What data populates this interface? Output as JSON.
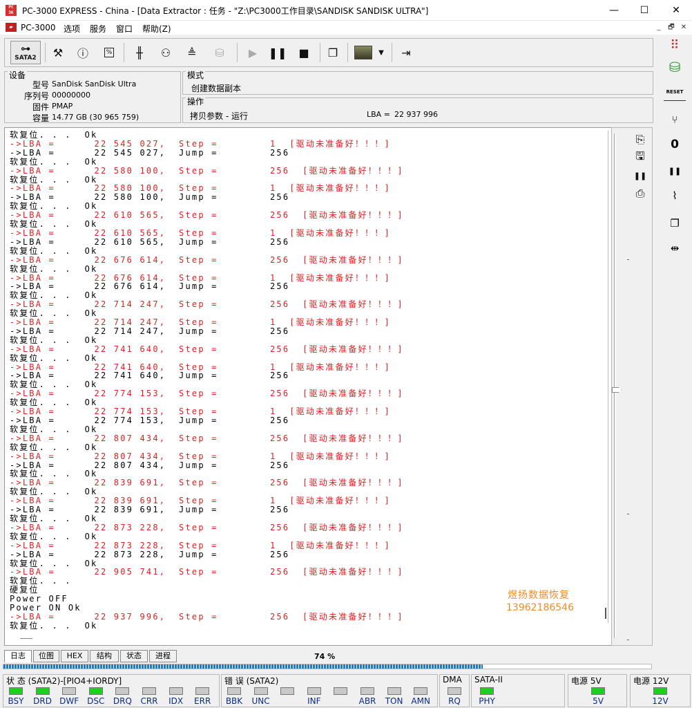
{
  "window": {
    "title": "PC-3000 EXPRESS - China - [Data Extractor : 任务 - \"Z:\\PC3000工作目录\\SANDISK SANDISK ULTRA\"]",
    "icon_text": "PC 3K",
    "minimize": "—",
    "maximize": "☐",
    "close": "✕"
  },
  "menu": {
    "items": [
      "PC-3000",
      "选项",
      "服务",
      "窗口",
      "帮助(Z)"
    ],
    "mdi_min": "_",
    "mdi_restore": "🗗",
    "mdi_close": "✕"
  },
  "toolbar": {
    "sata_label": "SATA2",
    "sata_icon": "⊶",
    "icons": [
      "wrench-hammer-icon",
      "disk-info-icon",
      "percent-100-icon",
      "head-config-icon",
      "binoculars-icon",
      "drive-tools-icon",
      "copy-db-icon",
      "play-icon",
      "pause-icon",
      "stop-icon",
      "windows-icon",
      "image-dropdown-icon",
      "exit-icon"
    ],
    "glyphs": {
      "tools": "⚒",
      "info": "ⓘ",
      "pct": "%",
      "head": "╫",
      "bino": "⚇",
      "drive": "≜",
      "copydb": "⛁",
      "play": "▶",
      "pause": "❚❚",
      "stop": "■",
      "windows": "❐",
      "img": "▦",
      "dd": "▼",
      "exit": "⇥"
    }
  },
  "device": {
    "group_title": "设备",
    "model_label": "型号",
    "model": "SanDisk SanDisk Ultra",
    "serial_label": "序列号",
    "serial": "00000000",
    "firmware_label": "固件",
    "firmware": "PMAP",
    "capacity_label": "容量",
    "capacity": "14.77 GB (30 965 759)"
  },
  "mode": {
    "group_title": "模式",
    "value": "创建数据副本"
  },
  "operation": {
    "group_title": "操作",
    "value": "拷贝参数 - 运行",
    "lba_label": "LBA =",
    "lba": "22 937 996"
  },
  "log": [
    {
      "c": "k",
      "t": "软复位. . .  Ok"
    },
    {
      "c": "r",
      "t": "->LBA =      22 545 027,  Step =        1  [驱动未准备好！！！]"
    },
    {
      "c": "k",
      "t": "->LBA =      22 545 027,  Jump =        256"
    },
    {
      "c": "k",
      "t": "软复位. . .  Ok"
    },
    {
      "c": "r",
      "t": "->LBA =      22 580 100,  Step =        256  [驱动未准备好！！！]"
    },
    {
      "c": "k",
      "t": "软复位. . .  Ok"
    },
    {
      "c": "r",
      "t": "->LBA =      22 580 100,  Step =        1  [驱动未准备好！！！]"
    },
    {
      "c": "k",
      "t": "->LBA =      22 580 100,  Jump =        256"
    },
    {
      "c": "k",
      "t": "软复位. . .  Ok"
    },
    {
      "c": "r",
      "t": "->LBA =      22 610 565,  Step =        256  [驱动未准备好！！！]"
    },
    {
      "c": "k",
      "t": "软复位. . .  Ok"
    },
    {
      "c": "r",
      "t": "->LBA =      22 610 565,  Step =        1  [驱动未准备好！！！]"
    },
    {
      "c": "k",
      "t": "->LBA =      22 610 565,  Jump =        256"
    },
    {
      "c": "k",
      "t": "软复位. . .  Ok"
    },
    {
      "c": "r",
      "t": "->LBA =      22 676 614,  Step =        256  [驱动未准备好！！！]"
    },
    {
      "c": "k",
      "t": "软复位. . .  Ok"
    },
    {
      "c": "r",
      "t": "->LBA =      22 676 614,  Step =        1  [驱动未准备好！！！]"
    },
    {
      "c": "k",
      "t": "->LBA =      22 676 614,  Jump =        256"
    },
    {
      "c": "k",
      "t": "软复位. . .  Ok"
    },
    {
      "c": "r",
      "t": "->LBA =      22 714 247,  Step =        256  [驱动未准备好！！！]"
    },
    {
      "c": "k",
      "t": "软复位. . .  Ok"
    },
    {
      "c": "r",
      "t": "->LBA =      22 714 247,  Step =        1  [驱动未准备好！！！]"
    },
    {
      "c": "k",
      "t": "->LBA =      22 714 247,  Jump =        256"
    },
    {
      "c": "k",
      "t": "软复位. . .  Ok"
    },
    {
      "c": "r",
      "t": "->LBA =      22 741 640,  Step =        256  [驱动未准备好！！！]"
    },
    {
      "c": "k",
      "t": "软复位. . .  Ok"
    },
    {
      "c": "r",
      "t": "->LBA =      22 741 640,  Step =        1  [驱动未准备好！！！]"
    },
    {
      "c": "k",
      "t": "->LBA =      22 741 640,  Jump =        256"
    },
    {
      "c": "k",
      "t": "软复位. . .  Ok"
    },
    {
      "c": "r",
      "t": "->LBA =      22 774 153,  Step =        256  [驱动未准备好！！！]"
    },
    {
      "c": "k",
      "t": "软复位. . .  Ok"
    },
    {
      "c": "r",
      "t": "->LBA =      22 774 153,  Step =        1  [驱动未准备好！！！]"
    },
    {
      "c": "k",
      "t": "->LBA =      22 774 153,  Jump =        256"
    },
    {
      "c": "k",
      "t": "软复位. . .  Ok"
    },
    {
      "c": "r",
      "t": "->LBA =      22 807 434,  Step =        256  [驱动未准备好！！！]"
    },
    {
      "c": "k",
      "t": "软复位. . .  Ok"
    },
    {
      "c": "r",
      "t": "->LBA =      22 807 434,  Step =        1  [驱动未准备好！！！]"
    },
    {
      "c": "k",
      "t": "->LBA =      22 807 434,  Jump =        256"
    },
    {
      "c": "k",
      "t": "软复位. . .  Ok"
    },
    {
      "c": "r",
      "t": "->LBA =      22 839 691,  Step =        256  [驱动未准备好！！！]"
    },
    {
      "c": "k",
      "t": "软复位. . .  Ok"
    },
    {
      "c": "r",
      "t": "->LBA =      22 839 691,  Step =        1  [驱动未准备好！！！]"
    },
    {
      "c": "k",
      "t": "->LBA =      22 839 691,  Jump =        256"
    },
    {
      "c": "k",
      "t": "软复位. . .  Ok"
    },
    {
      "c": "r",
      "t": "->LBA =      22 873 228,  Step =        256  [驱动未准备好！！！]"
    },
    {
      "c": "k",
      "t": "软复位. . .  Ok"
    },
    {
      "c": "r",
      "t": "->LBA =      22 873 228,  Step =        1  [驱动未准备好！！！]"
    },
    {
      "c": "k",
      "t": "->LBA =      22 873 228,  Jump =        256"
    },
    {
      "c": "k",
      "t": "软复位. . .  Ok"
    },
    {
      "c": "r",
      "t": "->LBA =      22 905 741,  Step =        256  [驱动未准备好！！！]"
    },
    {
      "c": "k",
      "t": "软复位. . ."
    },
    {
      "c": "k",
      "t": "硬复位"
    },
    {
      "c": "k",
      "t": "Power OFF"
    },
    {
      "c": "k",
      "t": "Power ON Ok"
    },
    {
      "c": "r",
      "t": "->LBA =      22 937 996,  Step =        256  [驱动未准备好！！！]"
    },
    {
      "c": "k",
      "t": "软复位. . .  Ok"
    }
  ],
  "watermark": {
    "line1": "煜扬数据恢复",
    "line2": "13962186546"
  },
  "tabs": [
    "日志",
    "位图",
    "HEX",
    "结构",
    "状态",
    "进程"
  ],
  "progress": {
    "label": "74 %",
    "fraction": 0.74
  },
  "status": {
    "group1_title": "状 态 (SATA2)-[PIO4+IORDY]",
    "group1": [
      {
        "name": "BSY",
        "on": true
      },
      {
        "name": "DRD",
        "on": true
      },
      {
        "name": "DWF",
        "on": false
      },
      {
        "name": "DSC",
        "on": true
      },
      {
        "name": "DRQ",
        "on": false
      },
      {
        "name": "CRR",
        "on": false
      },
      {
        "name": "IDX",
        "on": false
      },
      {
        "name": "ERR",
        "on": false
      }
    ],
    "group2_title": "错 误 (SATA2)",
    "group2": [
      {
        "name": "BBK",
        "on": false
      },
      {
        "name": "UNC",
        "on": false
      },
      {
        "name": "",
        "on": false
      },
      {
        "name": "INF",
        "on": false
      },
      {
        "name": "",
        "on": false
      },
      {
        "name": "ABR",
        "on": false
      },
      {
        "name": "TON",
        "on": false
      },
      {
        "name": "AMN",
        "on": false
      }
    ],
    "dma_title": "DMA",
    "dma": {
      "name": "RQ",
      "on": false
    },
    "sata_title": "SATA-II",
    "sata": {
      "name": "PHY",
      "on": true
    },
    "p5_title": "电源 5V",
    "p5": {
      "name": "5V",
      "on": true
    },
    "p12_title": "电源 12V",
    "p12": {
      "name": "12V",
      "on": true
    }
  },
  "sidebar": {
    "icons": [
      "grid-menu-icon",
      "database-icon",
      "reset-icon",
      "branch-icon",
      "zero-fill-icon",
      "pause-icon",
      "cable-icon",
      "copy-close-icon",
      "connector-icon"
    ],
    "glyphs": {
      "grid": "⠿",
      "db": "⛁",
      "reset": "RESET",
      "branch": "⑂",
      "zero": "0",
      "pause": "❚❚",
      "cable": "⌇",
      "copyx": "❐",
      "conn": "⇹"
    }
  },
  "strip": {
    "icons": [
      "import-icon",
      "save-icon",
      "pause-icon",
      "export-icon"
    ],
    "glyphs": {
      "import": "⎘",
      "save": "🖫",
      "pause": "❚❚",
      "export": "⎙"
    }
  }
}
